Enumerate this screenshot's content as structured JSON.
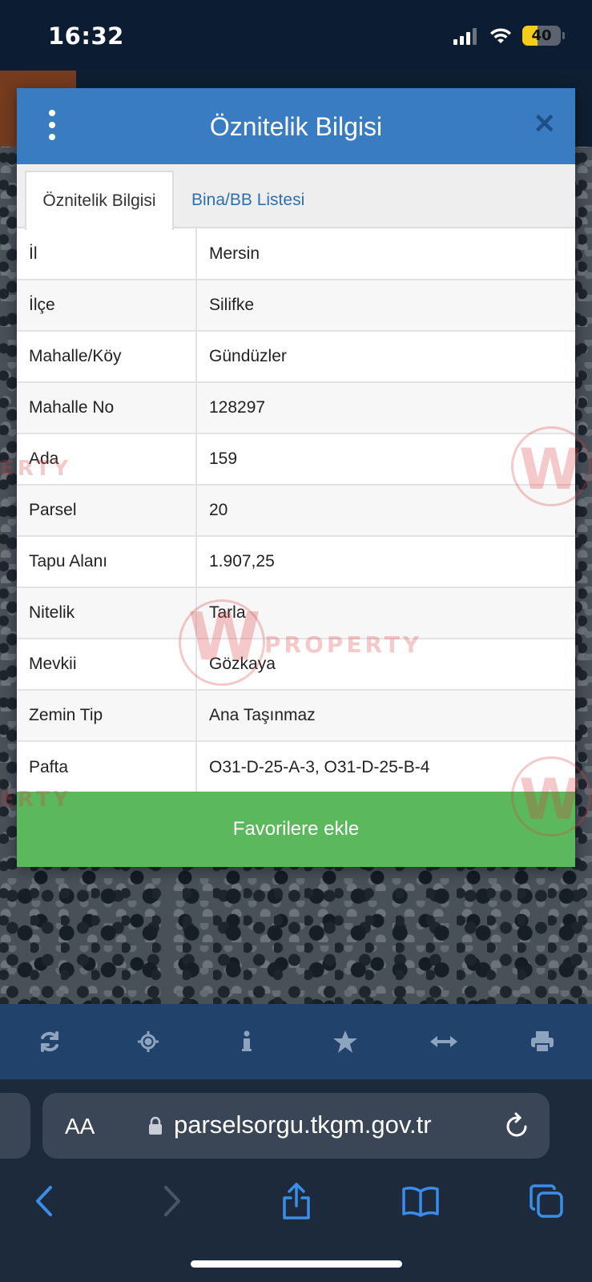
{
  "status_bar": {
    "time": "16:32",
    "battery_level": "40",
    "battery_fraction": 0.4
  },
  "modal": {
    "title": "Öznitelik Bilgisi",
    "close_label": "✕",
    "tabs": [
      {
        "label": "Öznitelik Bilgisi",
        "active": true
      },
      {
        "label": "Bina/BB Listesi",
        "active": false
      }
    ],
    "rows": [
      {
        "key": "İl",
        "value": "Mersin"
      },
      {
        "key": "İlçe",
        "value": "Silifke"
      },
      {
        "key": "Mahalle/Köy",
        "value": "Gündüzler"
      },
      {
        "key": "Mahalle No",
        "value": "128297"
      },
      {
        "key": "Ada",
        "value": "159"
      },
      {
        "key": "Parsel",
        "value": "20"
      },
      {
        "key": "Tapu Alanı",
        "value": "1.907,25"
      },
      {
        "key": "Nitelik",
        "value": "Tarla"
      },
      {
        "key": "Mevkii",
        "value": "Gözkaya"
      },
      {
        "key": "Zemin Tip",
        "value": "Ana Taşınmaz"
      },
      {
        "key": "Pafta",
        "value": "O31-D-25-A-3, O31-D-25-B-4"
      }
    ],
    "favorite_button": "Favorilere ekle"
  },
  "watermark": {
    "text": "PROPERTY",
    "partial_text": "ERTY",
    "logo_letter": "W"
  },
  "app_toolbar": {
    "icons": [
      "refresh-icon",
      "locate-icon",
      "info-icon",
      "star-icon",
      "measure-icon",
      "print-icon"
    ]
  },
  "safari": {
    "text_size_label": "AA",
    "url": "parselsorgu.tkgm.gov.tr"
  },
  "colors": {
    "header_blue": "#3a7cc2",
    "tab_link_blue": "#2f6fb0",
    "favorite_green": "#5cb85c",
    "toolbar_blue": "#21436b",
    "safari_accent": "#3b8ee8"
  }
}
